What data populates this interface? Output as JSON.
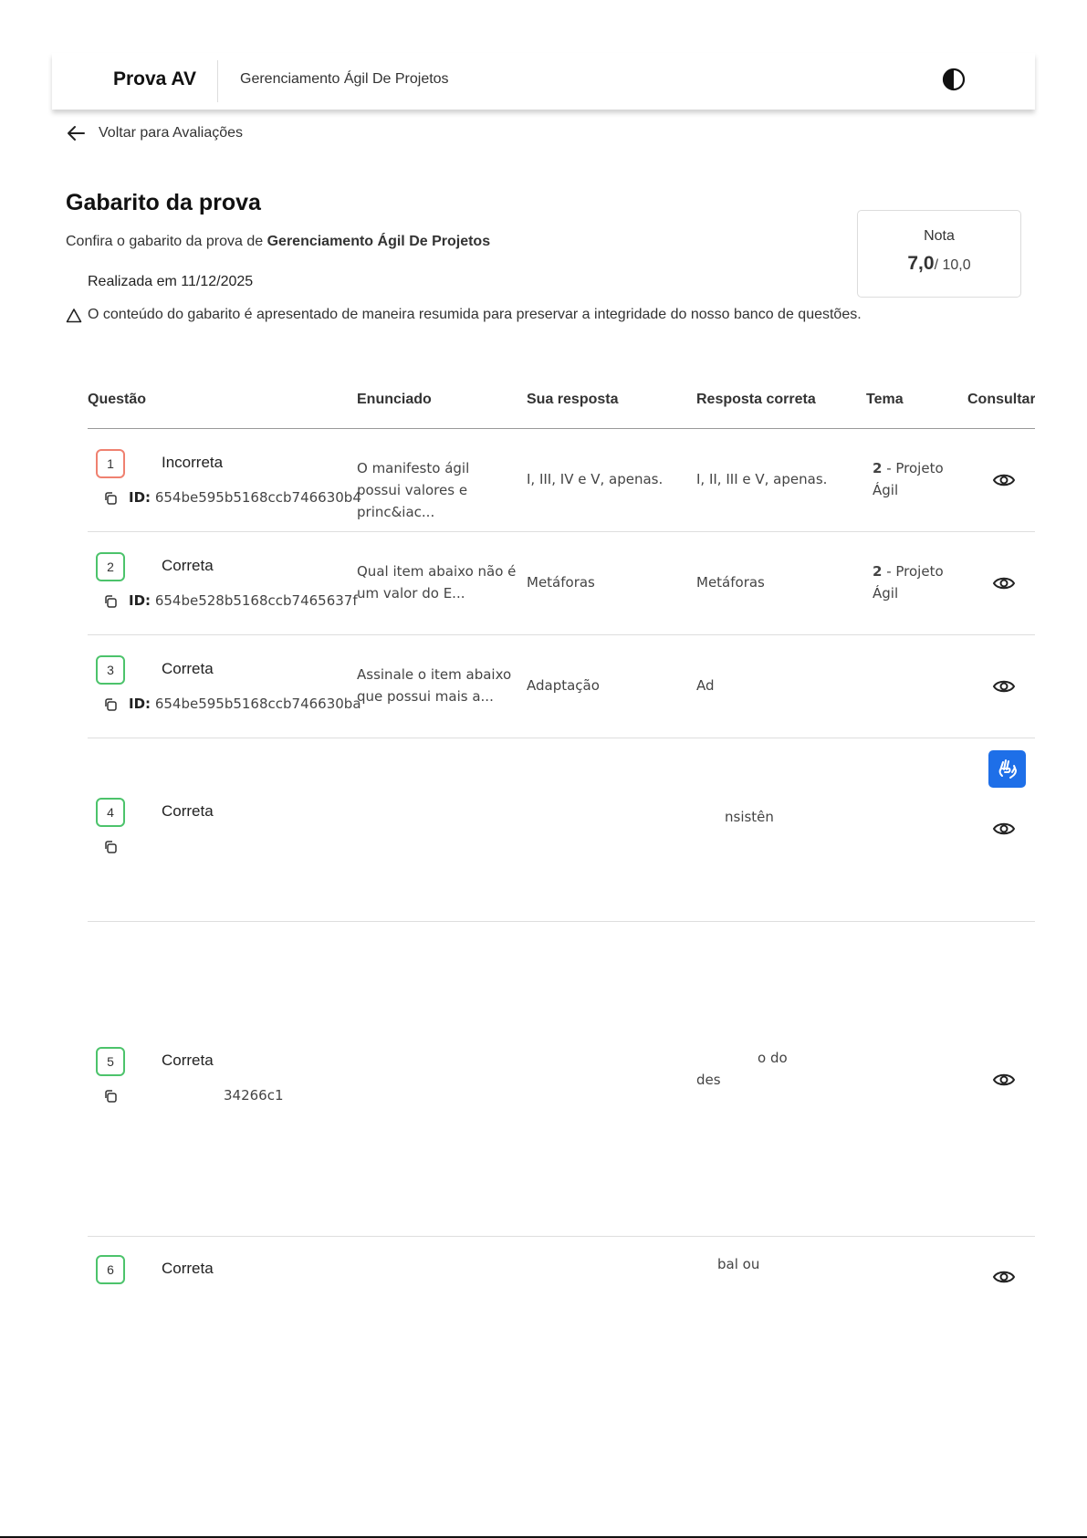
{
  "header": {
    "brand": "Prova AV",
    "subject": "Gerenciamento Ágil De Projetos"
  },
  "back_label": "Voltar para Avaliações",
  "page": {
    "title": "Gabarito da prova",
    "confirm_prefix": "Confira o gabarito da prova de ",
    "confirm_subject": "Gerenciamento Ágil De Projetos",
    "date": "Realizada em 11/12/2025",
    "warning": "O conteúdo do gabarito é apresentado de maneira resumida para preservar a integridade do nosso banco de questões."
  },
  "grade": {
    "label": "Nota",
    "value": "7,0",
    "max": "/ 10,0"
  },
  "table": {
    "headers": [
      "Questão",
      "Enunciado",
      "Sua resposta",
      "Resposta correta",
      "Tema",
      "Consultar"
    ],
    "rows": [
      {
        "number": "1",
        "status": "Incorreta",
        "correct": false,
        "id_label": "ID:",
        "id": "654be595b5168ccb746630b4",
        "statement": "O manifesto ágil possui valores e princ&iac...",
        "your_answer": "I, III, IV e V, apenas.",
        "correct_answer": "I, II, III e V, apenas.",
        "theme_num": "2",
        "theme": " - Projeto Ágil"
      },
      {
        "number": "2",
        "status": "Correta",
        "correct": true,
        "id_label": "ID:",
        "id": "654be528b5168ccb7465637f",
        "statement": "Qual item abaixo não é um valor do E...",
        "your_answer": "Metáforas",
        "correct_answer": "Metáforas",
        "theme_num": "2",
        "theme": " - Projeto Ágil"
      },
      {
        "number": "3",
        "status": "Correta",
        "correct": true,
        "id_label": "ID:",
        "id": "654be595b5168ccb746630ba",
        "statement": "Assinale o item abaixo que possui mais a...",
        "your_answer": "Adaptação",
        "correct_answer": "Ad"
      },
      {
        "number": "4",
        "status": "Correta",
        "correct": true,
        "correct_answer": "nsistên"
      },
      {
        "number": "5",
        "status": "Correta",
        "correct": true,
        "id": "34266c1",
        "correct_answer_line1": "o do",
        "correct_answer_line2": "des"
      },
      {
        "number": "6",
        "status": "Correta",
        "correct": true,
        "correct_answer": "bal ou"
      }
    ]
  },
  "colors": {
    "correct_border": "#4cc36b",
    "incorrect_border": "#ef8170",
    "libras_button": "#1e6fe8"
  }
}
